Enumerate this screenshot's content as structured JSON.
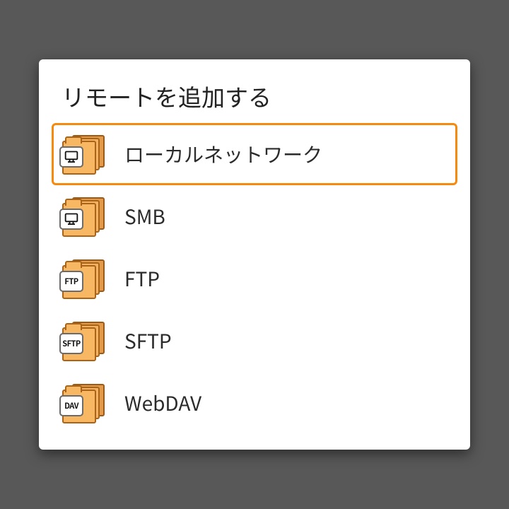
{
  "dialog": {
    "title": "リモートを追加する",
    "options": [
      {
        "label": "ローカルネットワーク",
        "badge": "monitor",
        "selected": true
      },
      {
        "label": "SMB",
        "badge": "monitor",
        "selected": false
      },
      {
        "label": "FTP",
        "badge": "FTP",
        "selected": false
      },
      {
        "label": "SFTP",
        "badge": "SFTP",
        "selected": false
      },
      {
        "label": "WebDAV",
        "badge": "DAV",
        "selected": false
      }
    ]
  },
  "colors": {
    "accent": "#f68a0c",
    "folder": "#f8b762"
  }
}
